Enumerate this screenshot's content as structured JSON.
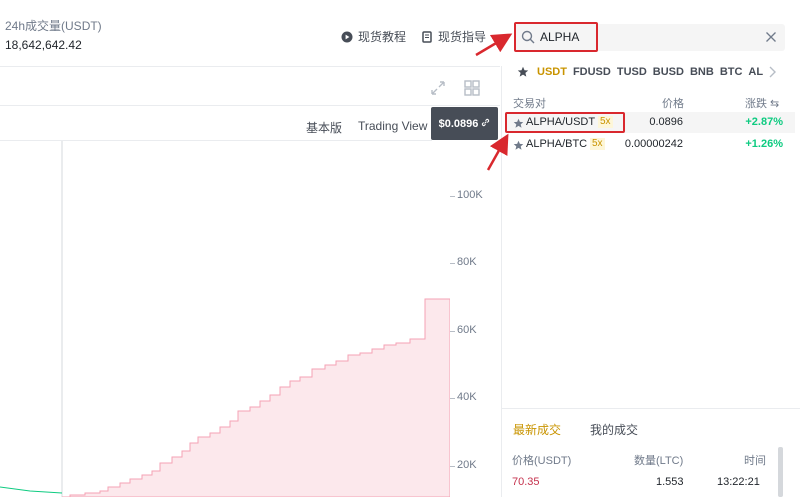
{
  "stats": {
    "volume_label": "24h成交量(USDT)",
    "volume_value": "18,642,642.42"
  },
  "header_links": {
    "tutorial": "现货教程",
    "guide": "现货指导"
  },
  "chart_views": {
    "basic": "基本版",
    "tradingview": "Trading View"
  },
  "current_price_pill": "$0.0896",
  "depth_axis": {
    "labels": [
      "100K",
      "80K",
      "60K",
      "40K",
      "20K"
    ],
    "values": [
      100000,
      80000,
      60000,
      40000,
      20000
    ]
  },
  "search": {
    "value": "ALPHA",
    "placeholder": ""
  },
  "quote_tabs": [
    "USDT",
    "FDUSD",
    "TUSD",
    "BUSD",
    "BNB",
    "BTC",
    "AL"
  ],
  "active_quote": "USDT",
  "pair_columns": {
    "pair": "交易对",
    "price": "价格",
    "change": "涨跌 ⇆"
  },
  "pairs": [
    {
      "name": "ALPHA/USDT",
      "leverage": "5x",
      "price": "0.0896",
      "change": "+2.87%"
    },
    {
      "name": "ALPHA/BTC",
      "leverage": "5x",
      "price": "0.00000242",
      "change": "+1.26%"
    }
  ],
  "trades_tabs": {
    "latest": "最新成交",
    "mine": "我的成交"
  },
  "trade_columns": {
    "price": "价格(USDT)",
    "qty": "数量(LTC)",
    "time": "时间"
  },
  "trades": [
    {
      "price": "70.35",
      "qty": "1.553",
      "time": "13:22:21"
    }
  ],
  "colors": {
    "accent": "#c99400",
    "positive": "#0ecb81",
    "negative": "#c5324d",
    "highlight": "#d9282e",
    "depth_fill": "#fce8ec",
    "depth_stroke": "#f5a2b4"
  }
}
